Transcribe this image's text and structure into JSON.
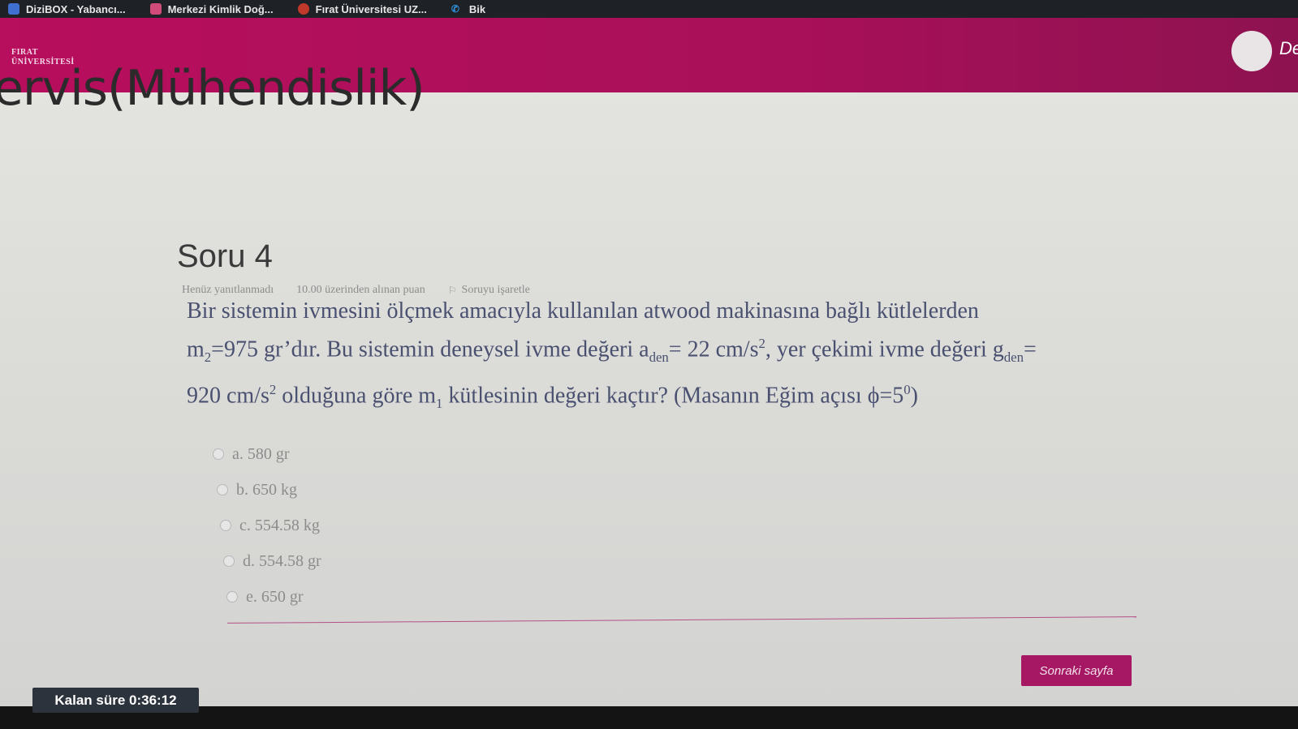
{
  "bookmarks": [
    {
      "label": "DiziBOX - Yabancı...",
      "icon": "bookmark-icon",
      "color": "#3f6fd1"
    },
    {
      "label": "Merkezi Kimlik Doğ...",
      "icon": "id-card-icon",
      "color": "#d14b7a"
    },
    {
      "label": "Fırat Üniversitesi UZ...",
      "icon": "university-icon",
      "color": "#c0392b"
    },
    {
      "label": "Bik",
      "icon": "phone-icon",
      "color": "#2f8fd8"
    }
  ],
  "header": {
    "logo_line1": "FIRAT",
    "logo_line2": "ÜNİVERSİTESİ",
    "user_name": "De",
    "color": "#b70e5d"
  },
  "course": {
    "title": "ervis(Mühendislik)"
  },
  "question": {
    "title": "Soru 4",
    "status": "Henüz yanıtlanmadı",
    "points": "10.00 üzerinden alınan puan",
    "flag_label": "Soruyu işaretle",
    "text": {
      "p1": "Bir sistemin ivmesini ölçmek amacıyla kullanılan atwood makinasına bağlı kütlelerden",
      "m2_var": "m",
      "m2_sub": "2",
      "p2": "=975 gr’dır. Bu sistemin deneysel ivme değeri a",
      "aden_sub": "den",
      "p3": "= 22 cm/s",
      "sq1": "2",
      "p4": ", yer çekimi ivme değeri g",
      "gden_sub": "den",
      "p5": "=",
      "p6": "920 cm/s",
      "sq2": "2",
      "p7": " olduğuna göre m",
      "m1_sub": "1",
      "p8": " kütlesinin değeri kaçtır? (Masanın Eğim açısı ϕ=5",
      "deg": "0",
      "p9": ")"
    },
    "options": [
      {
        "label": "a. 580 gr"
      },
      {
        "label": "b. 650 kg"
      },
      {
        "label": "c. 554.58 kg"
      },
      {
        "label": "d. 554.58 gr"
      },
      {
        "label": "e. 650 gr"
      }
    ]
  },
  "navigation": {
    "next_label": "Sonraki sayfa",
    "accent": "#a61864"
  },
  "timer": {
    "label": "Kalan süre",
    "value": "0:36:12"
  }
}
